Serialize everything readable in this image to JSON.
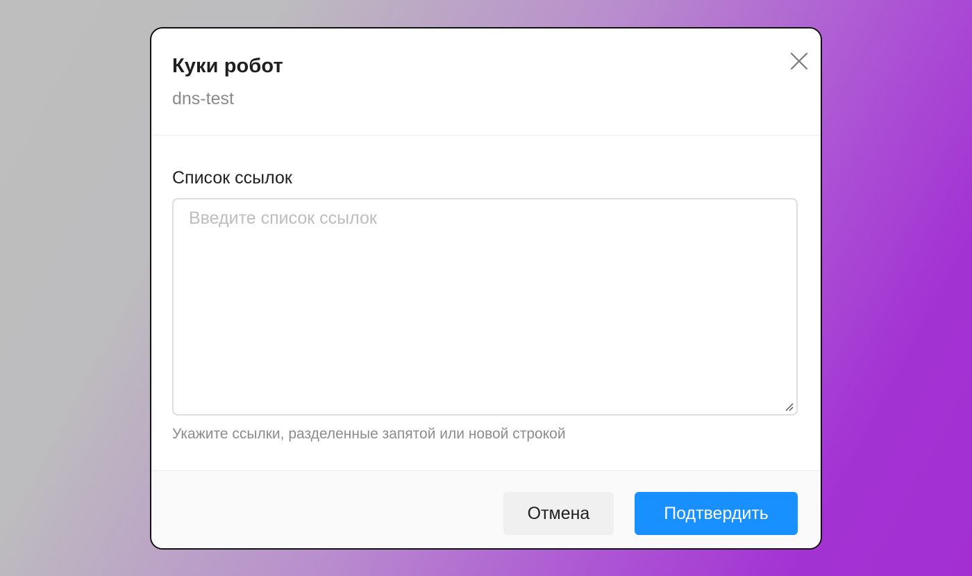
{
  "modal": {
    "title": "Куки робот",
    "subtitle": "dns-test",
    "close_icon": "close-icon"
  },
  "form": {
    "label": "Список ссылок",
    "placeholder": "Введите список ссылок",
    "value": "",
    "hint": "Укажите ссылки, разделенные запятой или новой строкой"
  },
  "footer": {
    "cancel_label": "Отмена",
    "confirm_label": "Подтвердить"
  },
  "colors": {
    "primary": "#1890ff",
    "cancel_bg": "#f0f0f0",
    "footer_bg": "#fafafa"
  }
}
